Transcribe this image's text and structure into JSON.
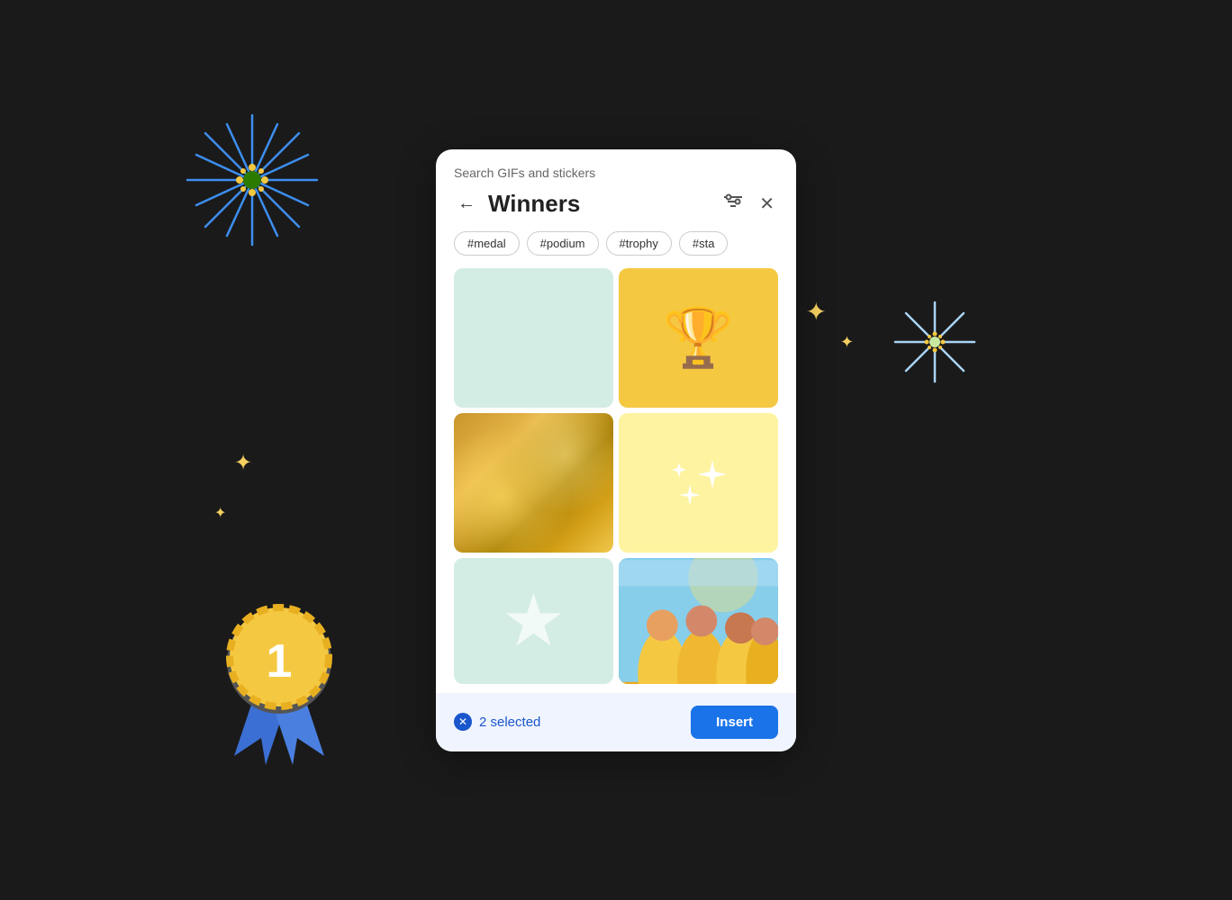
{
  "dialog": {
    "search_label": "Search GIFs and stickers",
    "title": "Winners",
    "tags": [
      "#medal",
      "#podium",
      "#trophy",
      "#sta"
    ],
    "filter_icon": "≡",
    "close_icon": "✕",
    "back_icon": "←",
    "bottom": {
      "selected_count": "2 selected",
      "insert_label": "Insert",
      "clear_icon": "✕"
    }
  },
  "decorations": {
    "sparkle_positions": [
      "top-left",
      "top-right",
      "bottom-left"
    ],
    "award_ribbon_number": "1"
  },
  "colors": {
    "blue_accent": "#1a73e8",
    "tag_border": "#cccccc",
    "mint_bg": "#d4ede4",
    "yellow_bg": "#f5c842",
    "light_yellow_bg": "#fef3a0",
    "bottom_bar_bg": "#f0f4ff"
  }
}
